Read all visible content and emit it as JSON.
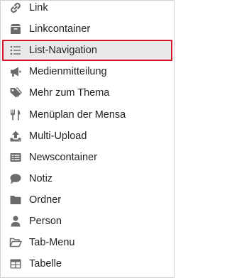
{
  "icon_color": "#6b6b6b",
  "highlight_color": "#d3172a",
  "menu": {
    "items": [
      {
        "label": "Link",
        "icon": "link-icon"
      },
      {
        "label": "Linkcontainer",
        "icon": "box-icon"
      },
      {
        "label": "List-Navigation",
        "icon": "list-icon",
        "selected": true
      },
      {
        "label": "Medienmitteilung",
        "icon": "megaphone-icon"
      },
      {
        "label": "Mehr zum Thema",
        "icon": "tags-icon"
      },
      {
        "label": "Menüplan der Mensa",
        "icon": "cutlery-icon"
      },
      {
        "label": "Multi-Upload",
        "icon": "upload-icon"
      },
      {
        "label": "Newscontainer",
        "icon": "newspaper-icon"
      },
      {
        "label": "Notiz",
        "icon": "comment-icon"
      },
      {
        "label": "Ordner",
        "icon": "folder-icon"
      },
      {
        "label": "Person",
        "icon": "user-icon"
      },
      {
        "label": "Tab-Menu",
        "icon": "folder-open-icon"
      },
      {
        "label": "Tabelle",
        "icon": "table-icon"
      }
    ]
  }
}
